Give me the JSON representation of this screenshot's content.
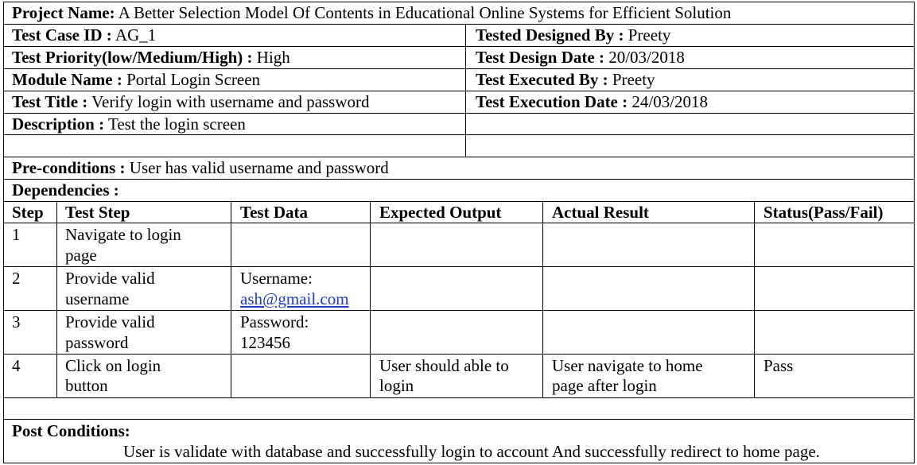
{
  "project": {
    "label": "Project Name:",
    "value": "A Better Selection Model Of Contents in Educational Online Systems for Efficient Solution"
  },
  "left": {
    "test_case_id": {
      "label": "Test Case ID :",
      "value": "AG_1"
    },
    "priority": {
      "label": "Test Priority(low/Medium/High) :",
      "value": "High"
    },
    "module": {
      "label": "Module Name :",
      "value": "Portal Login Screen"
    },
    "title": {
      "label": "Test Title :",
      "value": "Verify login with username and password"
    },
    "description": {
      "label": "Description :",
      "value": "Test the login screen"
    }
  },
  "right": {
    "designed_by": {
      "label": "Tested Designed By :",
      "value": "Preety"
    },
    "design_date": {
      "label": "Test Design Date :",
      "value": "20/03/2018"
    },
    "executed_by": {
      "label": "Test Executed By :",
      "value": "Preety"
    },
    "execution_date": {
      "label": "Test Execution Date :",
      "value": "24/03/2018"
    }
  },
  "preconditions": {
    "label": "Pre-conditions :",
    "value": "User has valid username and password"
  },
  "dependencies": {
    "label": "Dependencies :"
  },
  "table": {
    "headers": [
      "Step",
      "Test Step",
      "Test Data",
      "Expected Output",
      "Actual Result",
      "Status(Pass/Fail)"
    ],
    "rows": [
      {
        "step": "1",
        "test_step_l1": "Navigate to login",
        "test_step_l2": "page",
        "data_l1": "",
        "data_l2": "",
        "expected_l1": "",
        "expected_l2": "",
        "actual_l1": "",
        "actual_l2": "",
        "status": ""
      },
      {
        "step": "2",
        "test_step_l1": "Provide valid",
        "test_step_l2": "username",
        "data_l1": "Username:",
        "data_l2": "ash@gmail.com",
        "expected_l1": "",
        "expected_l2": "",
        "actual_l1": "",
        "actual_l2": "",
        "status": ""
      },
      {
        "step": "3",
        "test_step_l1": "Provide valid",
        "test_step_l2": "password",
        "data_l1": "Password:",
        "data_l2": "123456",
        "expected_l1": "",
        "expected_l2": "",
        "actual_l1": "",
        "actual_l2": "",
        "status": ""
      },
      {
        "step": "4",
        "test_step_l1": "Click on login",
        "test_step_l2": "button",
        "data_l1": "",
        "data_l2": "",
        "expected_l1": "User should able to",
        "expected_l2": "login",
        "actual_l1": "User navigate to home",
        "actual_l2": "page after login",
        "status": "Pass"
      }
    ]
  },
  "postconditions": {
    "label": "Post Conditions:",
    "value": "User is validate with database and successfully login to account  And successfully redirect to home page."
  }
}
